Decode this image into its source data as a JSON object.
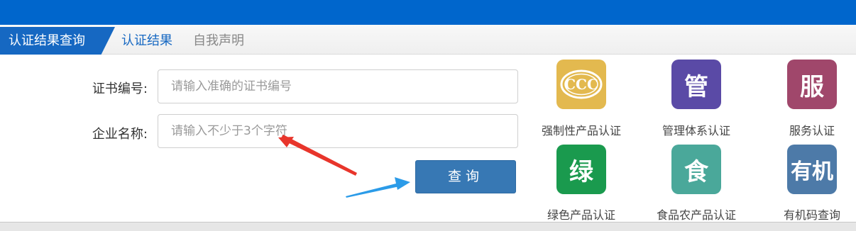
{
  "tabs": {
    "active": "认证结果查询",
    "items": [
      "认证结果",
      "自我声明"
    ]
  },
  "form": {
    "cert_label": "证书编号:",
    "cert_placeholder": "请输入准确的证书编号",
    "company_label": "企业名称:",
    "company_placeholder": "请输入不少于3个字符",
    "search_button": "查询"
  },
  "services": [
    {
      "icon": "ccc-icon",
      "glyph": "",
      "label": "强制性产品认证",
      "color": "#e3b94f"
    },
    {
      "icon": "management-icon",
      "glyph": "管",
      "label": "管理体系认证",
      "color": "#5a4aa6"
    },
    {
      "icon": "service-icon",
      "glyph": "服",
      "label": "服务认证",
      "color": "#a0476b"
    },
    {
      "icon": "green-icon",
      "glyph": "绿",
      "label": "绿色产品认证",
      "color": "#1a9a4e"
    },
    {
      "icon": "food-icon",
      "glyph": "食",
      "label": "食品农产品认证",
      "color": "#4aa89a"
    },
    {
      "icon": "organic-icon",
      "glyph": "有机",
      "label": "有机码查询",
      "color": "#4d7aa8"
    }
  ],
  "annotation_colors": {
    "red_arrow": "#e8352b",
    "blue_arrow": "#2b9be8"
  }
}
